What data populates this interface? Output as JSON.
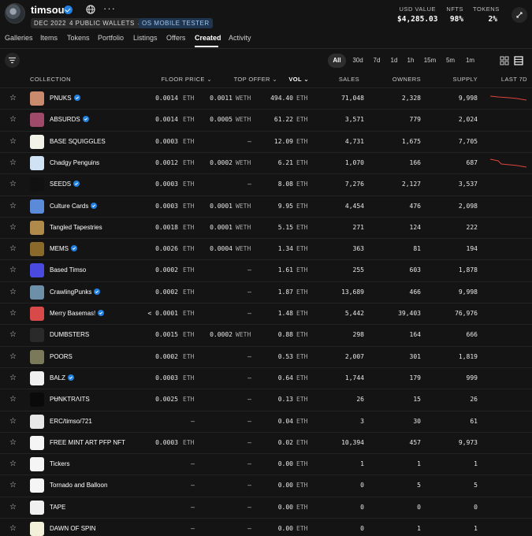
{
  "header": {
    "username": "timsou",
    "pills": [
      "DEC 2022",
      "4 PUBLIC WALLETS",
      "OS MOBILE TESTER"
    ],
    "stats": [
      {
        "label": "USD VALUE",
        "value": "$4,285.03"
      },
      {
        "label": "NFTS",
        "value": "98%"
      },
      {
        "label": "TOKENS",
        "value": "2%"
      }
    ],
    "icons": [
      "globe-icon",
      "more-icon",
      "expand-icon"
    ]
  },
  "tabs": [
    "Galleries",
    "Items",
    "Tokens",
    "Portfolio",
    "Listings",
    "Offers",
    "Created",
    "Activity"
  ],
  "active_tab": "Created",
  "time_filters": [
    "All",
    "30d",
    "7d",
    "1d",
    "1h",
    "15m",
    "5m",
    "1m"
  ],
  "active_time_filter": "All",
  "columns": {
    "collection": "COLLECTION",
    "floor": "FLOOR PRICE",
    "offer": "TOP OFFER",
    "vol": "VOL",
    "sales": "SALES",
    "owners": "OWNERS",
    "supply": "SUPPLY",
    "last": "LAST 7D"
  },
  "units": {
    "eth": "ETH",
    "weth": "WETH"
  },
  "rows": [
    {
      "name": "PNUKS",
      "verified": true,
      "floor": "0.0014",
      "offer": "0.0011",
      "vol": "494.40",
      "sales": "71,048",
      "owners": "2,328",
      "supply": "9,998",
      "thumb": "#c98a6e",
      "spark": "a"
    },
    {
      "name": "ABSURDS",
      "verified": true,
      "floor": "0.0014",
      "offer": "0.0005",
      "vol": "61.22",
      "sales": "3,571",
      "owners": "779",
      "supply": "2,024",
      "thumb": "#a04a6a"
    },
    {
      "name": "BASE SQUIGGLES",
      "verified": false,
      "floor": "0.0003",
      "offer": "–",
      "vol": "12.09",
      "sales": "4,731",
      "owners": "1,675",
      "supply": "7,705",
      "thumb": "#f2f2e8"
    },
    {
      "name": "Chadgy Penguins",
      "verified": false,
      "floor": "0.0012",
      "offer": "0.0002",
      "vol": "6.21",
      "sales": "1,070",
      "owners": "166",
      "supply": "687",
      "thumb": "#cfe3f5",
      "spark": "b"
    },
    {
      "name": "SEEDS",
      "verified": true,
      "floor": "0.0003",
      "offer": "–",
      "vol": "8.08",
      "sales": "7,276",
      "owners": "2,127",
      "supply": "3,537",
      "thumb": "#111111"
    },
    {
      "name": "Culture Cards",
      "verified": true,
      "floor": "0.0003",
      "offer": "0.0001",
      "vol": "9.95",
      "sales": "4,454",
      "owners": "476",
      "supply": "2,098",
      "thumb": "#5a8ad8"
    },
    {
      "name": "Tangled Tapestries",
      "verified": false,
      "floor": "0.0018",
      "offer": "0.0001",
      "vol": "5.15",
      "sales": "271",
      "owners": "124",
      "supply": "222",
      "thumb": "#b08a4a"
    },
    {
      "name": "MEMS",
      "verified": true,
      "floor": "0.0026",
      "offer": "0.0004",
      "vol": "1.34",
      "sales": "363",
      "owners": "81",
      "supply": "194",
      "thumb": "#8a6a2a"
    },
    {
      "name": "Based Timso",
      "verified": false,
      "floor": "0.0002",
      "offer": "–",
      "vol": "1.61",
      "sales": "255",
      "owners": "603",
      "supply": "1,878",
      "thumb": "#4a4ae0"
    },
    {
      "name": "CrawlingPunks",
      "verified": true,
      "floor": "0.0002",
      "offer": "–",
      "vol": "1.87",
      "sales": "13,689",
      "owners": "466",
      "supply": "9,998",
      "thumb": "#6e8fa8"
    },
    {
      "name": "Merry Basemas!",
      "verified": true,
      "floor": "< 0.0001",
      "offer": "–",
      "vol": "1.48",
      "sales": "5,442",
      "owners": "39,403",
      "supply": "76,976",
      "thumb": "#d84a4a"
    },
    {
      "name": "DUMBSTERS",
      "verified": false,
      "floor": "0.0015",
      "offer": "0.0002",
      "vol": "0.88",
      "sales": "298",
      "owners": "164",
      "supply": "666",
      "thumb": "#2a2a2a"
    },
    {
      "name": "POORS",
      "verified": false,
      "floor": "0.0002",
      "offer": "–",
      "vol": "0.53",
      "sales": "2,007",
      "owners": "301",
      "supply": "1,819",
      "thumb": "#7a7a5a"
    },
    {
      "name": "BALZ",
      "verified": true,
      "floor": "0.0003",
      "offer": "–",
      "vol": "0.64",
      "sales": "1,744",
      "owners": "179",
      "supply": "999",
      "thumb": "#f0f0f0"
    },
    {
      "name": "PɄNKTRɅITS",
      "verified": false,
      "floor": "0.0025",
      "offer": "–",
      "vol": "0.13",
      "sales": "26",
      "owners": "15",
      "supply": "26",
      "thumb": "#0a0a0a"
    },
    {
      "name": "ERC/timso/721",
      "verified": false,
      "floor": "–",
      "offer": "–",
      "vol": "0.04",
      "sales": "3",
      "owners": "30",
      "supply": "61",
      "thumb": "#e8e8e8"
    },
    {
      "name": "FREE MINT ART PFP NFT",
      "verified": false,
      "floor": "0.0003",
      "offer": "–",
      "vol": "0.02",
      "sales": "10,394",
      "owners": "457",
      "supply": "9,973",
      "thumb": "#f5f5f5"
    },
    {
      "name": "Tickers",
      "verified": false,
      "floor": "–",
      "offer": "–",
      "vol": "0.00",
      "sales": "1",
      "owners": "1",
      "supply": "1",
      "thumb": "#f5f5f5"
    },
    {
      "name": "Tornado and Balloon",
      "verified": false,
      "floor": "–",
      "offer": "–",
      "vol": "0.00",
      "sales": "0",
      "owners": "5",
      "supply": "5",
      "thumb": "#f5f5f5"
    },
    {
      "name": "TAPE",
      "verified": false,
      "floor": "–",
      "offer": "–",
      "vol": "0.00",
      "sales": "0",
      "owners": "0",
      "supply": "0",
      "thumb": "#f0f0f0"
    },
    {
      "name": "DAWN OF SPIN",
      "verified": false,
      "floor": "–",
      "offer": "–",
      "vol": "0.00",
      "sales": "0",
      "owners": "1",
      "supply": "1",
      "thumb": "#f2f0d8"
    }
  ]
}
